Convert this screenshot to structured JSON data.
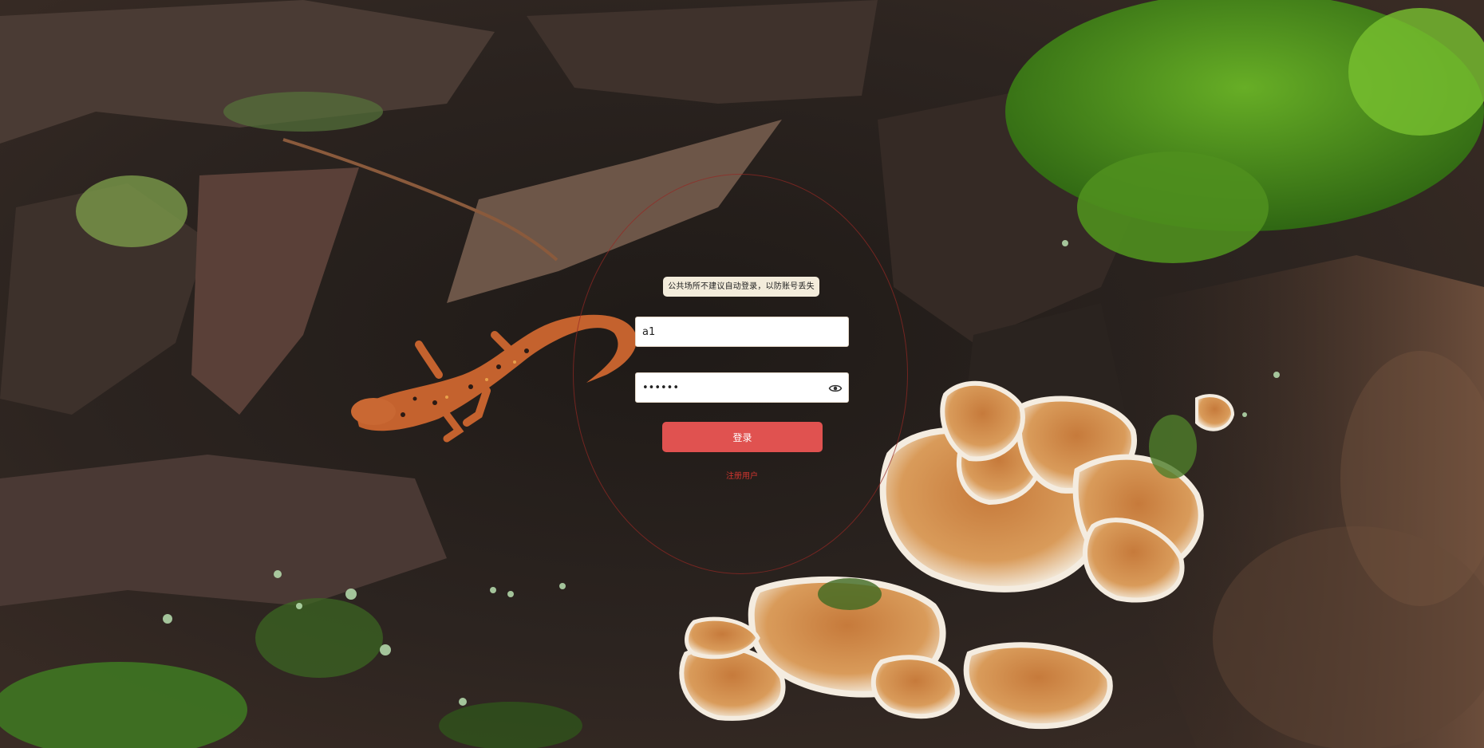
{
  "login": {
    "tip": "公共场所不建议自动登录，以防账号丢失",
    "username_value": "a1",
    "password_value": "••••••",
    "submit_label": "登录",
    "register_label": "注册用户"
  },
  "icons": {
    "password_toggle": "eye-icon"
  },
  "colors": {
    "submit_button": "#e05250",
    "register_link": "#d2352f",
    "tip_background": "#f3ecdb"
  }
}
